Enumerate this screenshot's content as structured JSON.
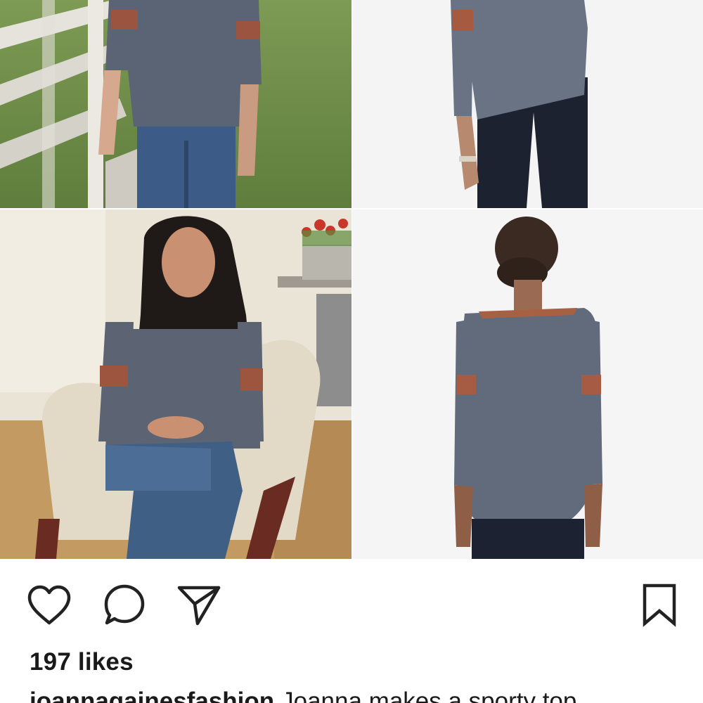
{
  "post": {
    "images": [
      {
        "name": "outfit-photo-walking",
        "description": "Woman in grey raglan tee with rust sleeve stripes and jeans walking by white fence"
      },
      {
        "name": "product-photo-front",
        "description": "Model wearing grey heathered tee with rust sleeve stripes and dark jeans, front view"
      },
      {
        "name": "outfit-photo-seated",
        "description": "Woman with long dark hair seated in beige armchair wearing grey tee with rust stripes"
      },
      {
        "name": "product-photo-back",
        "description": "Model wearing grey heathered tee, back view with rust stripes on sleeves"
      }
    ],
    "actions": {
      "like_icon": "heart-icon",
      "comment_icon": "speech-bubble-icon",
      "share_icon": "paper-plane-icon",
      "save_icon": "bookmark-icon"
    },
    "likes_text": "197 likes",
    "caption": {
      "username": "joannagainesfashion",
      "text": "Joanna makes a sporty top"
    }
  },
  "colors": {
    "tee_grey": "#5b6677",
    "stripe_rust": "#a4573d",
    "denim": "#3a5577",
    "text": "#1a1a1a",
    "icon": "#222222"
  }
}
